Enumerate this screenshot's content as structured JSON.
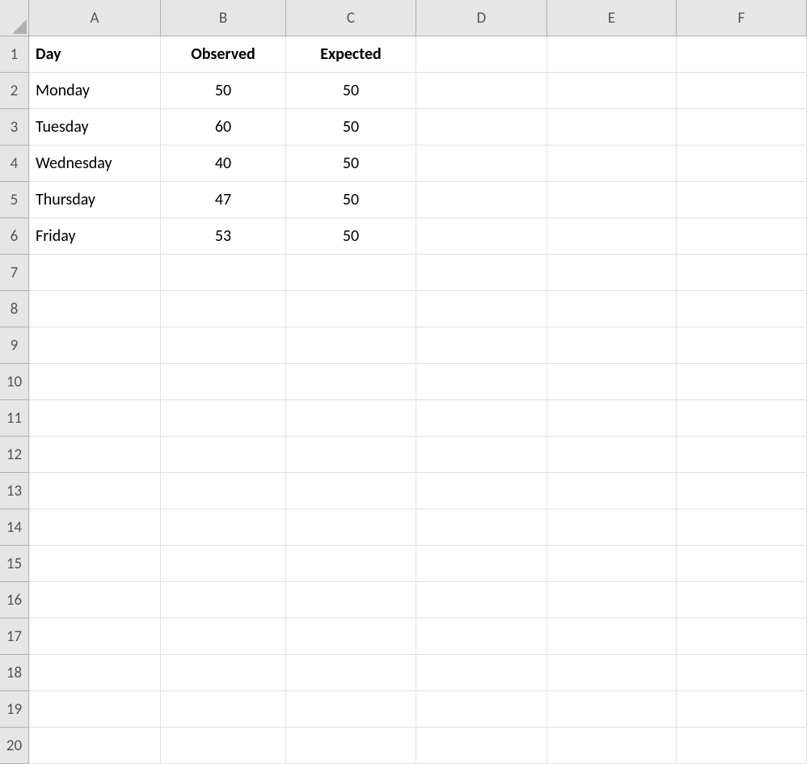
{
  "columns": [
    "A",
    "B",
    "C",
    "D",
    "E",
    "F"
  ],
  "row_count": 20,
  "headers": {
    "A": "Day",
    "B": "Observed",
    "C": "Expected"
  },
  "rows": [
    {
      "day": "Monday",
      "observed": "50",
      "expected": "50"
    },
    {
      "day": "Tuesday",
      "observed": "60",
      "expected": "50"
    },
    {
      "day": "Wednesday",
      "observed": "40",
      "expected": "50"
    },
    {
      "day": "Thursday",
      "observed": "47",
      "expected": "50"
    },
    {
      "day": "Friday",
      "observed": "53",
      "expected": "50"
    }
  ],
  "chart_data": {
    "type": "table",
    "title": "",
    "columns": [
      "Day",
      "Observed",
      "Expected"
    ],
    "data": [
      [
        "Monday",
        50,
        50
      ],
      [
        "Tuesday",
        60,
        50
      ],
      [
        "Wednesday",
        40,
        50
      ],
      [
        "Thursday",
        47,
        50
      ],
      [
        "Friday",
        53,
        50
      ]
    ]
  }
}
